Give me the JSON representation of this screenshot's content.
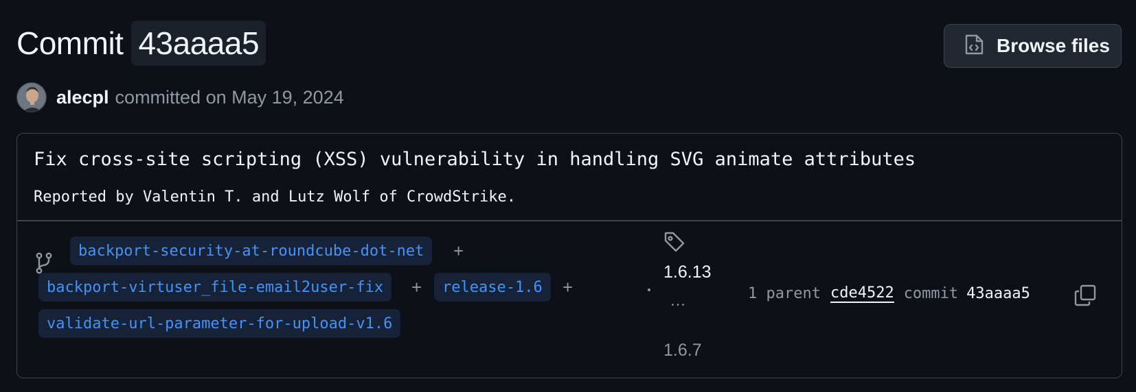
{
  "header": {
    "title_word": "Commit",
    "title_sha": "43aaaa5"
  },
  "browse_button": {
    "label": "Browse files",
    "icon": "file-code-icon"
  },
  "author": {
    "name": "alecpl",
    "committed_text": "committed on May 19, 2024"
  },
  "commit": {
    "message": "Fix cross-site scripting (XSS) vulnerability in handling SVG animate attributes",
    "body": "Reported by Valentin T. and Lutz Wolf of CrowdStrike."
  },
  "branches": {
    "icon": "git-branch-icon",
    "items": [
      "backport-security-at-roundcube-dot-net",
      "backport-virtuser_file-email2user-fix",
      "release-1.6",
      "validate-url-parameter-for-upload-v1.6"
    ],
    "separator": "+"
  },
  "tags": {
    "icon": "tag-icon",
    "newest": "1.6.13",
    "ellipsis": "…",
    "oldest": "1.6.7"
  },
  "parents": {
    "parent_text": "1 parent",
    "parent_sha": "cde4522",
    "commit_label": "commit",
    "commit_sha": "43aaaa5",
    "copy_icon": "copy-icon"
  },
  "colors": {
    "background": "#0d1117",
    "accent_link": "#4493f8",
    "muted_text": "#9198a1",
    "border": "#3d444d"
  }
}
